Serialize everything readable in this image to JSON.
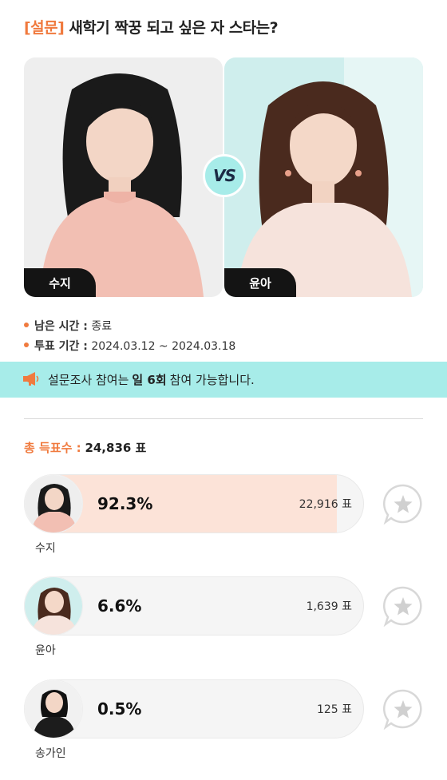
{
  "header": {
    "tag": "[설문]",
    "question": "새학기 짝꿍 되고 싶은 자 스타는?"
  },
  "matchup": {
    "left_name": "수지",
    "right_name": "윤아",
    "vs_label": "VS"
  },
  "info": {
    "remaining_label": "남은 시간 :",
    "remaining_value": "종료",
    "period_label": "투표 기간 :",
    "period_value": "2024.03.12 ~ 2024.03.18"
  },
  "notice": {
    "prefix": "설문조사 참여는",
    "highlight": "일 6회",
    "suffix": "참여 가능합니다."
  },
  "total": {
    "label": "총 득표수 :",
    "value": "24,836 표"
  },
  "results": [
    {
      "name": "수지",
      "percent_text": "92.3%",
      "votes_text": "22,916 표",
      "fill": 0.923
    },
    {
      "name": "윤아",
      "percent_text": "6.6%",
      "votes_text": "1,639 표",
      "fill": 0.066
    },
    {
      "name": "송가인",
      "percent_text": "0.5%",
      "votes_text": "125 표",
      "fill": 0.005
    }
  ],
  "colors": {
    "accent": "#f07a3e",
    "notice_bg": "#a7ece9",
    "bar_fill": "#fce3d8",
    "bar_bg": "#f5f5f5"
  },
  "icons": {
    "notice": "megaphone-icon",
    "vote": "star-chat-icon"
  }
}
